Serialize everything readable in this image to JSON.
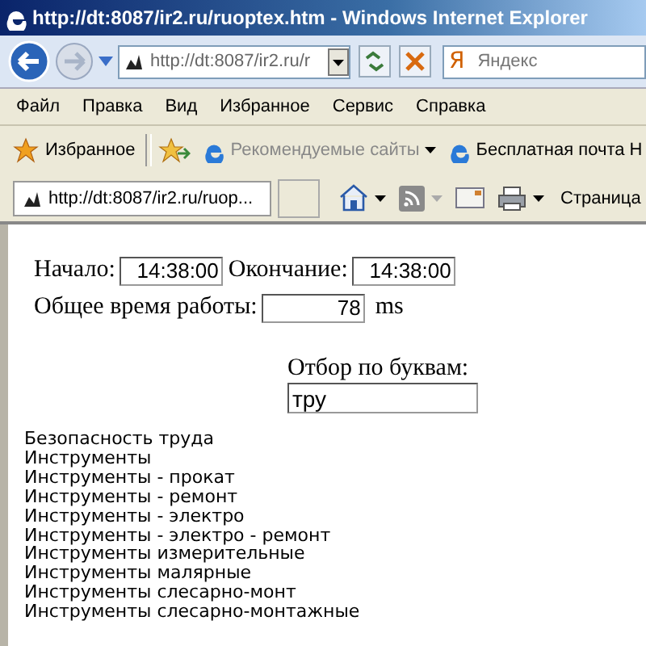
{
  "window": {
    "title": "http://dt:8087/ir2.ru/ruoptex.htm - Windows Internet Explorer"
  },
  "address_bar": {
    "value": "http://dt:8087/ir2.ru/r"
  },
  "search": {
    "logo": "Я",
    "placeholder": "Яндекс"
  },
  "menu": [
    "Файл",
    "Правка",
    "Вид",
    "Избранное",
    "Сервис",
    "Справка"
  ],
  "favorites_bar": {
    "label": "Избранное",
    "links": [
      {
        "label": "Рекомендуемые сайты",
        "dropdown": true
      },
      {
        "label": "Бесплатная почта H",
        "dropdown": false
      }
    ]
  },
  "tabs": [
    {
      "label": "http://dt:8087/ir2.ru/ruop...",
      "selected": true
    }
  ],
  "command_bar": {
    "page_menu": "Страница"
  },
  "form": {
    "start_label": "Начало:",
    "start_value": "14:38:00",
    "end_label": "Окончание:",
    "end_value": "14:38:00",
    "total_label": "Общее время работы:",
    "total_value": "78",
    "unit": "ms",
    "filter_label": "Отбор по буквам:",
    "filter_value": "тру"
  },
  "list": [
    "Безопасность труда",
    "Инструменты",
    "Инструменты - прокат",
    "Инструменты - ремонт",
    "Инструменты - электро",
    "Инструменты - электро - ремонт",
    "Инструменты измерительные",
    "Инструменты малярные",
    "Инструменты слесарно-монт",
    "Инструменты слесарно-монтажные"
  ]
}
